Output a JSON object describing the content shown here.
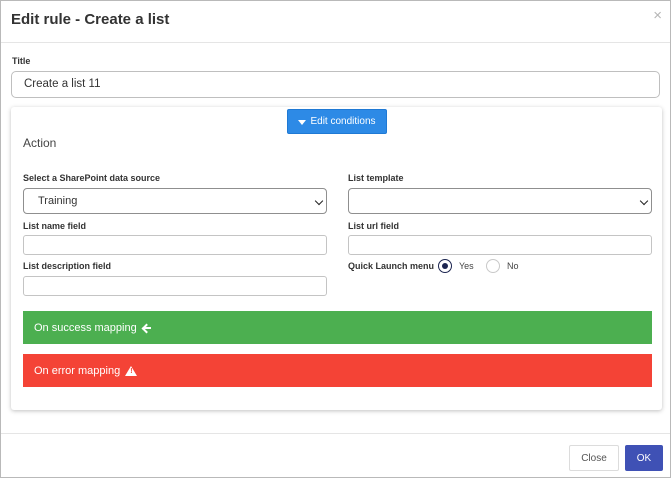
{
  "dialog": {
    "title": "Edit rule - Create a list",
    "close_glyph": "×"
  },
  "title_field": {
    "label": "Title",
    "value": "Create a list 11"
  },
  "conditions": {
    "button_label": "Edit conditions",
    "icon": "filter-icon"
  },
  "action": {
    "heading": "Action",
    "data_source": {
      "label": "Select a SharePoint data source",
      "value": "Training"
    },
    "list_template": {
      "label": "List template",
      "value": ""
    },
    "list_name": {
      "label": "List name field",
      "value": ""
    },
    "list_url": {
      "label": "List url field",
      "value": ""
    },
    "list_description": {
      "label": "List description field",
      "value": ""
    },
    "quick_launch": {
      "label": "Quick Launch menu",
      "options": [
        "Yes",
        "No"
      ],
      "selected": "Yes"
    }
  },
  "mappings": {
    "success": {
      "label": "On success mapping",
      "icon": "arrow-left-icon",
      "color": "#4caf50"
    },
    "error": {
      "label": "On error mapping",
      "icon": "warning-icon",
      "color": "#f44336"
    }
  },
  "footer": {
    "close_label": "Close",
    "ok_label": "OK"
  },
  "colors": {
    "primary": "#3f51b5",
    "info": "#2d8ae6"
  }
}
